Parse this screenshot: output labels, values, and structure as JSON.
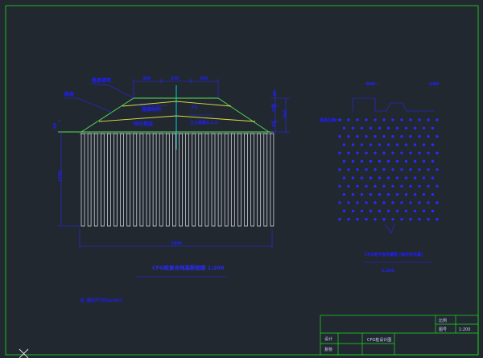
{
  "drawing": {
    "section_title": "CFG桩复合地基断面图 1:200",
    "plan_title": "CFG桩平面布置图 (梅花形布置)",
    "plan_scale": "1:200",
    "note": "注: 图中尺寸均以cm计。",
    "labels": {
      "subgrade": "路基填筑",
      "crown": "路面结构",
      "cushion": "碎石垫层",
      "geogrid": "土工格栅",
      "shoulder": "路肩",
      "slope": "1:1.5",
      "gradient": "2%",
      "left_edge": "路基边缘",
      "pile_len": "1200",
      "width": "1800",
      "top_dim_1": "300",
      "top_dim_2": "350",
      "top_dim_3": "300",
      "right_dim_1": "50",
      "right_dim_2": "150",
      "right_dim_3": "60",
      "right_dim_total": "260",
      "left_thk": "60",
      "spacing_1": "150",
      "spacing_2": "150",
      "plan_edge": "路基边缘"
    }
  },
  "title_block": {
    "cell_1": "比例",
    "cell_2": "图号",
    "cell_3": "1:200",
    "designer": "设计",
    "checker": "复核",
    "drawing_name": "CFG桩设计图"
  },
  "colors": {
    "background": "#212830",
    "frame": "#22dd22",
    "dimension": "#2a2aff",
    "pile": "#e8e8e8",
    "embankment": "#55e055",
    "layer": "#e0e040",
    "centerline": "#00e8e8"
  }
}
